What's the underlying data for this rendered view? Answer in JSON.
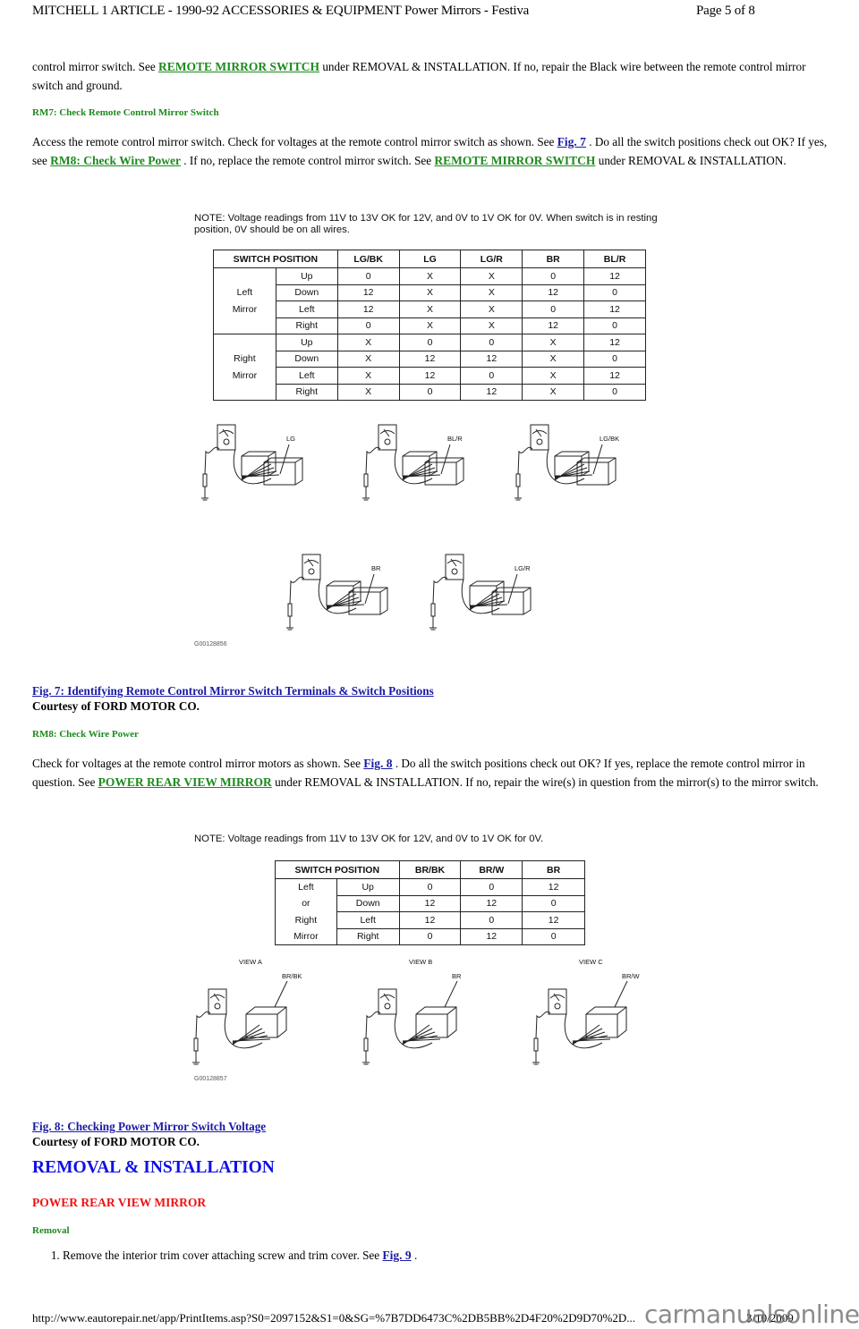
{
  "header": {
    "title": "MITCHELL 1 ARTICLE - 1990-92 ACCESSORIES & EQUIPMENT Power Mirrors - Festiva",
    "page": "Page 5 of 8"
  },
  "intro": {
    "pre": "control mirror switch. See ",
    "link": "REMOTE MIRROR SWITCH",
    "post": " under REMOVAL & INSTALLATION. If no, repair the Black wire between the remote control mirror switch and ground."
  },
  "rm7": {
    "heading": "RM7: Check Remote Control Mirror Switch",
    "p1": "Access the remote control mirror switch. Check for voltages at the remote control mirror switch as shown. See ",
    "fig_link": "Fig. 7",
    "p2": " . Do all the switch positions check out OK? If yes, see ",
    "rm8_link": "RM8: Check Wire Power",
    "p3": " . If no, replace the remote control mirror switch. See ",
    "switch_link": "REMOTE MIRROR SWITCH",
    "p4": " under REMOVAL & INSTALLATION."
  },
  "fig7": {
    "note": "NOTE: Voltage readings from 11V to 13V OK for 12V, and 0V to 1V OK for 0V. When switch is in resting position, 0V should be on all wires.",
    "table": {
      "headers": [
        "SWITCH POSITION",
        "LG/BK",
        "LG",
        "LG/R",
        "BR",
        "BL/R"
      ],
      "groups": [
        {
          "label_line1": "Left",
          "label_line2": "Mirror",
          "rows": [
            {
              "pos": "Up",
              "values": [
                "0",
                "X",
                "X",
                "0",
                "12"
              ]
            },
            {
              "pos": "Down",
              "values": [
                "12",
                "X",
                "X",
                "12",
                "0"
              ]
            },
            {
              "pos": "Left",
              "values": [
                "12",
                "X",
                "X",
                "0",
                "12"
              ]
            },
            {
              "pos": "Right",
              "values": [
                "0",
                "X",
                "X",
                "12",
                "0"
              ]
            }
          ]
        },
        {
          "label_line1": "Right",
          "label_line2": "Mirror",
          "rows": [
            {
              "pos": "Up",
              "values": [
                "X",
                "0",
                "0",
                "X",
                "12"
              ]
            },
            {
              "pos": "Down",
              "values": [
                "X",
                "12",
                "12",
                "X",
                "0"
              ]
            },
            {
              "pos": "Left",
              "values": [
                "X",
                "12",
                "0",
                "X",
                "12"
              ]
            },
            {
              "pos": "Right",
              "values": [
                "X",
                "0",
                "12",
                "X",
                "0"
              ]
            }
          ]
        }
      ]
    },
    "wire_labels": [
      "LG",
      "BL/R",
      "LG/BK",
      "BR",
      "LG/R"
    ],
    "code": "G00128856",
    "caption_link": "Fig. 7: Identifying Remote Control Mirror Switch Terminals & Switch Positions",
    "courtesy": "Courtesy of FORD MOTOR CO."
  },
  "rm8": {
    "heading": "RM8: Check Wire Power",
    "p1": "Check for voltages at the remote control mirror motors as shown. See ",
    "fig_link": "Fig. 8",
    "p2": " . Do all the switch positions check out OK? If yes, replace the remote control mirror in question. See ",
    "mirror_link": "POWER REAR VIEW MIRROR",
    "p3": " under REMOVAL & INSTALLATION. If no, repair the wire(s) in question from the mirror(s) to the mirror switch."
  },
  "fig8": {
    "note": "NOTE: Voltage readings from 11V to 13V OK for 12V, and 0V to 1V OK for 0V.",
    "table": {
      "headers": [
        "SWITCH POSITION",
        "BR/BK",
        "BR/W",
        "BR"
      ],
      "group_labels": [
        "Left",
        "or",
        "Right",
        "Mirror"
      ],
      "rows": [
        {
          "pos": "Up",
          "values": [
            "0",
            "0",
            "12"
          ]
        },
        {
          "pos": "Down",
          "values": [
            "12",
            "12",
            "0"
          ]
        },
        {
          "pos": "Left",
          "values": [
            "12",
            "0",
            "12"
          ]
        },
        {
          "pos": "Right",
          "values": [
            "0",
            "12",
            "0"
          ]
        }
      ]
    },
    "views": [
      {
        "view": "VIEW A",
        "wire": "BR/BK"
      },
      {
        "view": "VIEW B",
        "wire": "BR"
      },
      {
        "view": "VIEW C",
        "wire": "BR/W"
      }
    ],
    "code": "G00128857",
    "caption_link": "Fig. 8: Checking Power Mirror Switch Voltage",
    "courtesy": "Courtesy of FORD MOTOR CO."
  },
  "removal_installation": {
    "heading": "REMOVAL & INSTALLATION",
    "subheading": "POWER REAR VIEW MIRROR",
    "removal_label": "Removal",
    "steps": [
      {
        "pre": "Remove the interior trim cover attaching screw and trim cover. See ",
        "link": "Fig. 9",
        "post": " ."
      }
    ]
  },
  "footer": {
    "url": "http://www.eautorepair.net/app/PrintItems.asp?S0=2097152&S1=0&SG=%7B7DD6473C%2DB5BB%2D4F20%2D9D70%2D...",
    "date": "3/10/2009",
    "watermark": "carmanualsonline.info"
  },
  "colors": {
    "green_link": "#1d8a1d",
    "blue_link": "#1a1aa6",
    "section_blue": "#1010e6",
    "subsection_red": "#ee1111"
  }
}
